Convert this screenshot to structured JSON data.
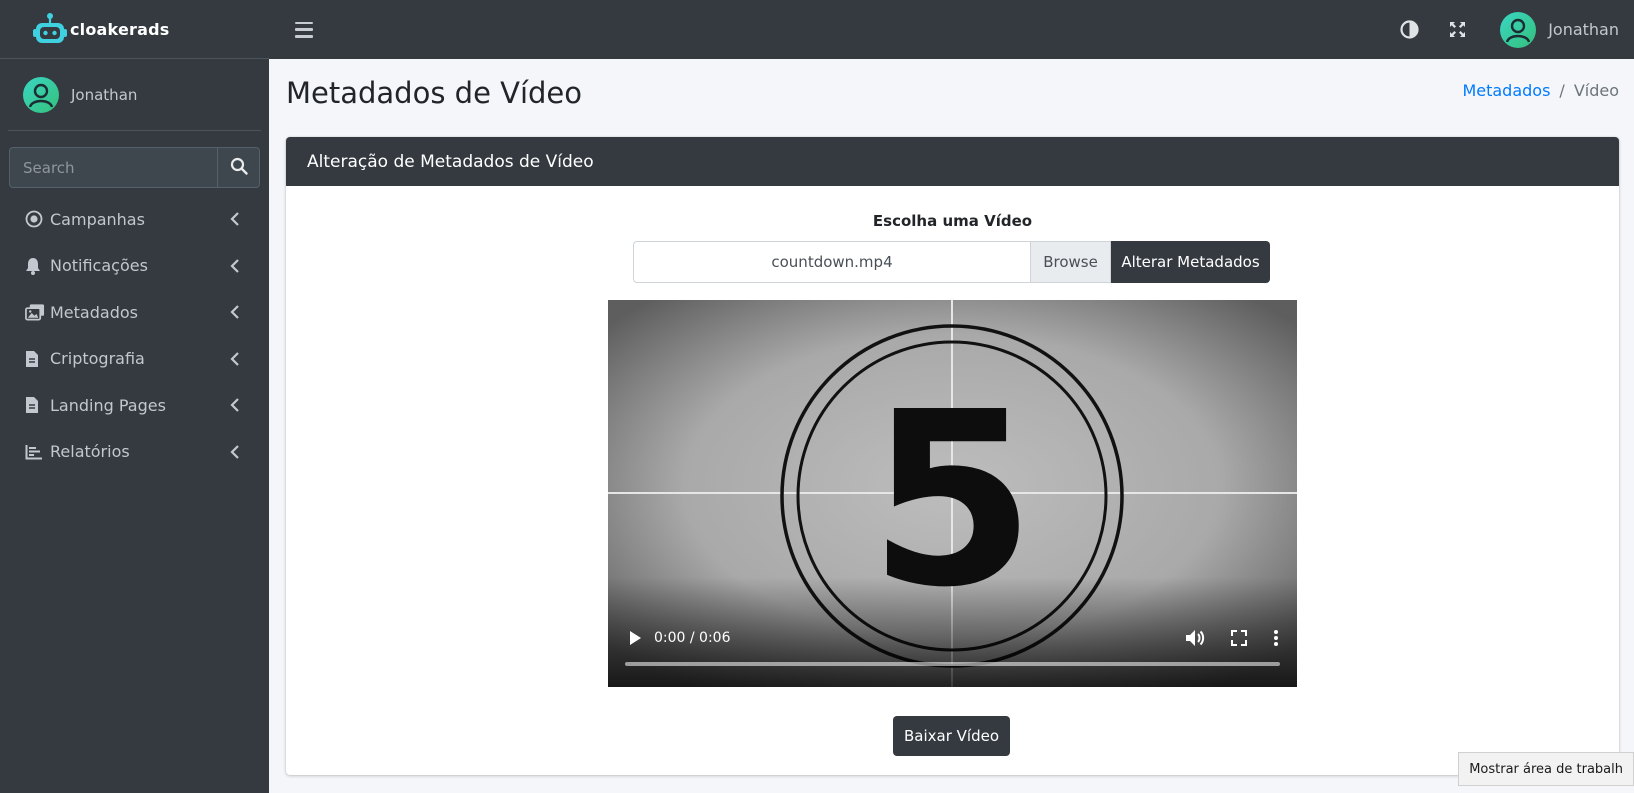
{
  "brand": {
    "name": "cloakerads"
  },
  "sidebar": {
    "user_name": "Jonathan",
    "search": {
      "placeholder": "Search",
      "value": ""
    },
    "items": [
      {
        "label": "Campanhas",
        "icon": "circle-dot-icon"
      },
      {
        "label": "Notificações",
        "icon": "bell-icon"
      },
      {
        "label": "Metadados",
        "icon": "images-icon"
      },
      {
        "label": "Criptografia",
        "icon": "file-icon"
      },
      {
        "label": "Landing Pages",
        "icon": "file-icon"
      },
      {
        "label": "Relatórios",
        "icon": "chart-icon"
      }
    ]
  },
  "topbar": {
    "user_name": "Jonathan",
    "icons": [
      "menu-icon",
      "contrast-icon",
      "fullscreen-icon"
    ]
  },
  "page": {
    "title": "Metadados de Vídeo",
    "breadcrumb": {
      "link": "Metadados",
      "separator": "/",
      "active": "Vídeo"
    }
  },
  "card": {
    "header": "Alteração de Metadados de Vídeo",
    "field_label": "Escolha uma Vídeo",
    "file_name": "countdown.mp4",
    "browse_label": "Browse",
    "submit_label": "Alterar Metadados",
    "video": {
      "time": "0:00 / 0:06",
      "frame_number": "5",
      "progress": 0
    },
    "download_label": "Baixar Vídeo"
  },
  "tooltip": {
    "text": "Mostrar área de trabalh"
  },
  "colors": {
    "sidebar_bg": "#343a40",
    "content_bg": "#f4f6f9",
    "link": "#007bff",
    "avatar": "#3ad6c4"
  }
}
